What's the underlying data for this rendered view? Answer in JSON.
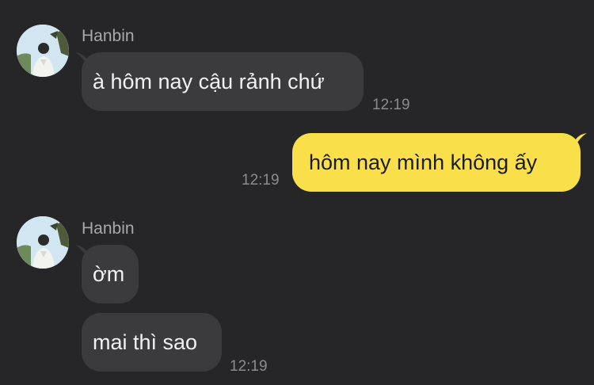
{
  "colors": {
    "background": "#262628",
    "incoming_bubble": "#3b3b3d",
    "outgoing_bubble": "#f9e04b",
    "name_text": "#a9a9ab",
    "time_text": "#8c8c8e"
  },
  "messages": [
    {
      "sender": "Hanbin",
      "avatar_icon": "profile-photo-avatar",
      "direction": "incoming",
      "bubbles": [
        {
          "text": "à hôm nay cậu rảnh chứ"
        }
      ],
      "time": "12:19"
    },
    {
      "direction": "outgoing",
      "bubbles": [
        {
          "text": "hôm nay mình không ấy"
        }
      ],
      "time": "12:19"
    },
    {
      "sender": "Hanbin",
      "avatar_icon": "profile-photo-avatar",
      "direction": "incoming",
      "bubbles": [
        {
          "text": "ờm"
        },
        {
          "text": "mai thì sao"
        }
      ],
      "time": "12:19"
    }
  ]
}
